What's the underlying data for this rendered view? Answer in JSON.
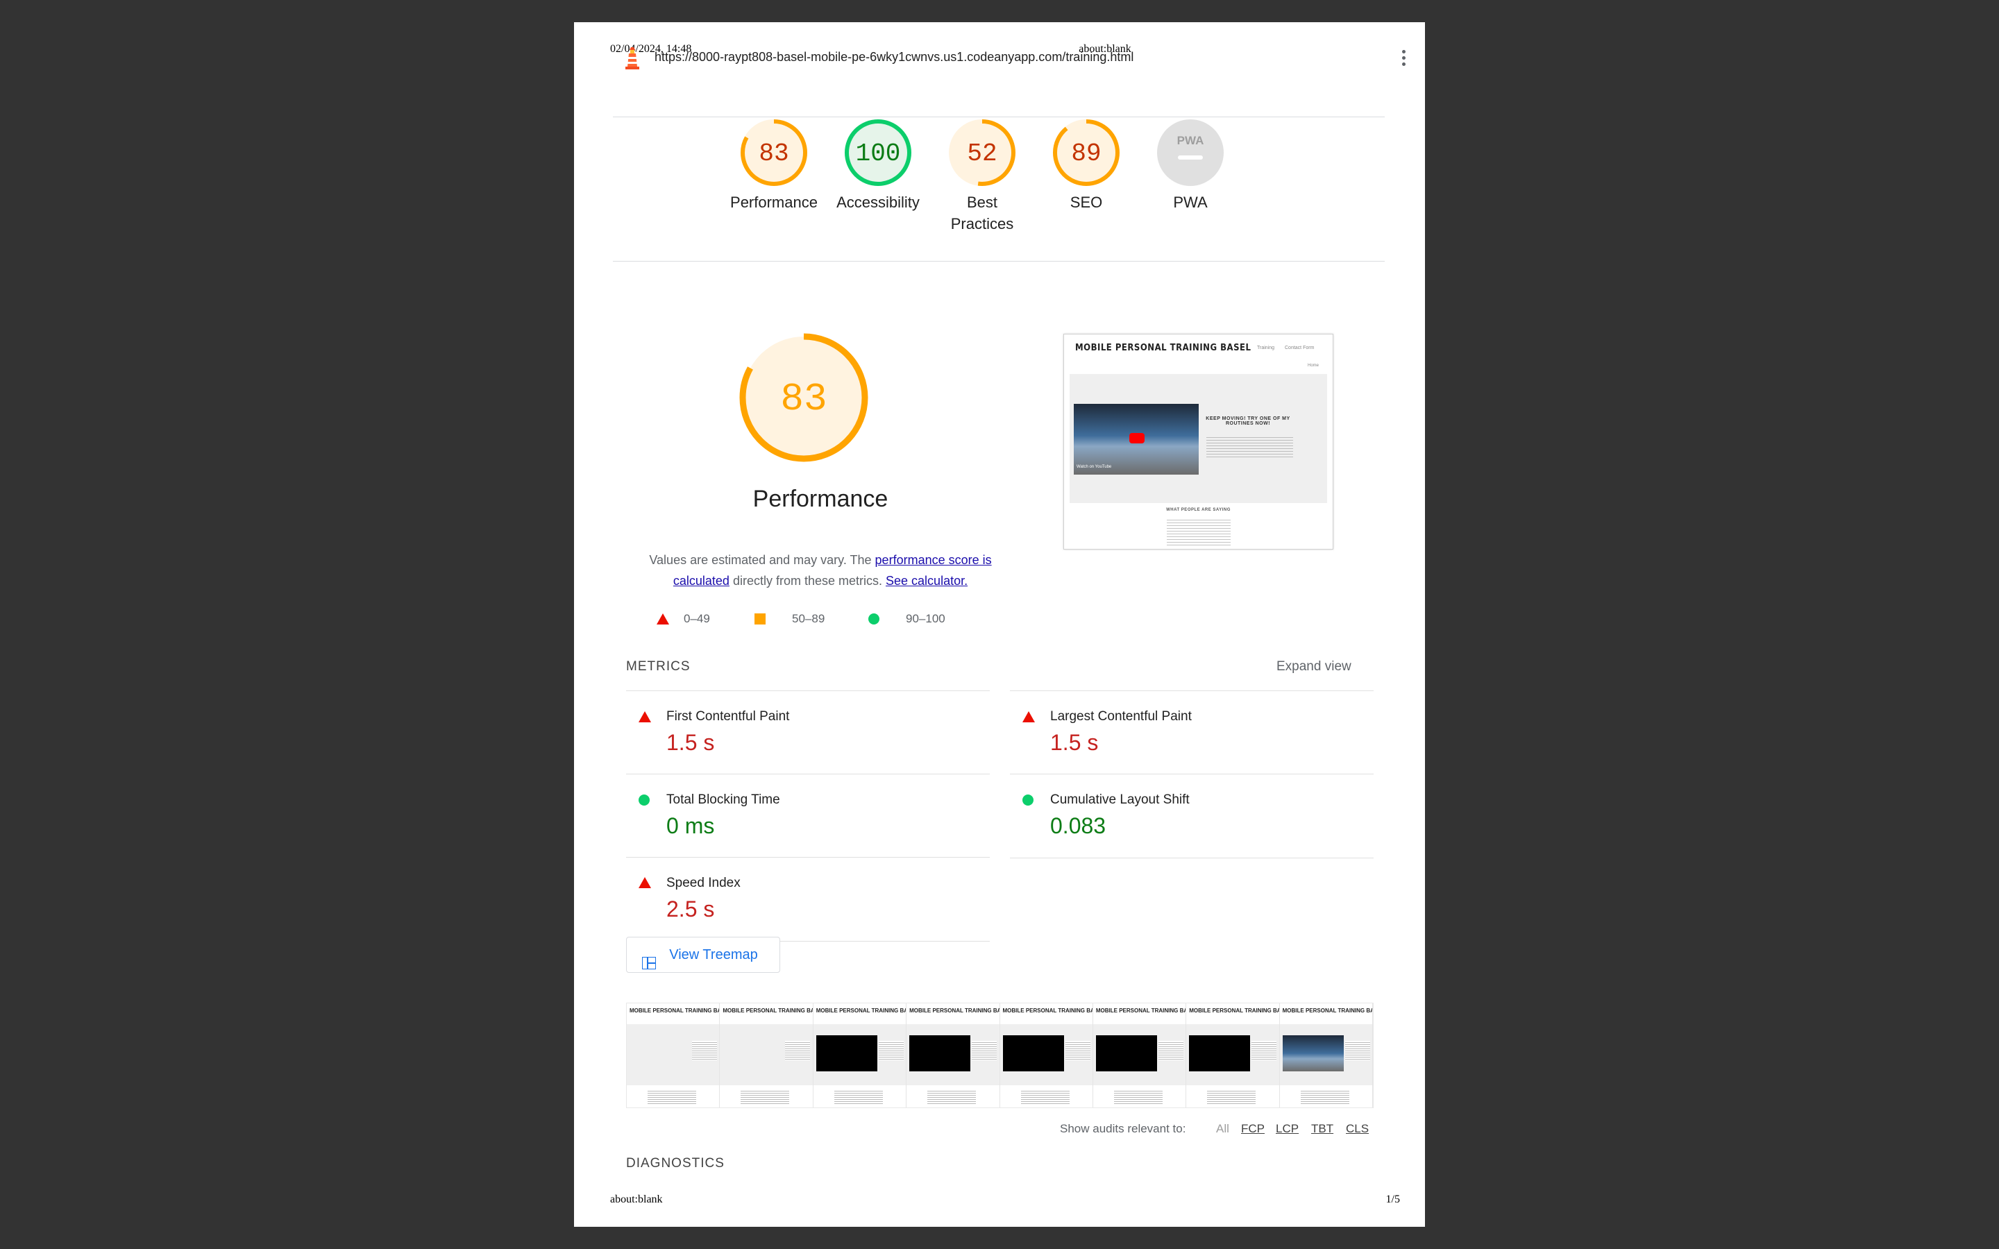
{
  "print_header": {
    "datetime": "02/04/2024, 14:48",
    "title": "about:blank"
  },
  "print_footer": {
    "left": "about:blank",
    "page": "1/5"
  },
  "topbar": {
    "url": "https://8000-raypt808-basel-mobile-pe-6wky1cwnvs.us1.codeanyapp.com/training.html"
  },
  "colors": {
    "average": "#e67700",
    "pass": "#0c7c15",
    "fail": "#c5221f",
    "gauge_avg_fill": "#fff3e0",
    "gauge_pass_fill": "#e6f4ea",
    "link": "#1a0dab",
    "treemap_btn": "#1a73e8"
  },
  "scores": [
    {
      "value": "83",
      "label": "Performance",
      "status": "average"
    },
    {
      "value": "100",
      "label": "Accessibility",
      "status": "pass"
    },
    {
      "value": "52",
      "label_line1": "Best",
      "label_line2": "Practices",
      "status": "average"
    },
    {
      "value": "89",
      "label": "SEO",
      "status": "average"
    },
    {
      "value": "",
      "label": "PWA",
      "badge": "PWA",
      "status": "na"
    }
  ],
  "performance": {
    "score": "83",
    "title": "Performance",
    "desc_part1": "Values are estimated and may vary. The ",
    "desc_link1": "performance score is calculated",
    "desc_part2": " directly from these metrics. ",
    "desc_link2": "See calculator.",
    "legend": [
      "0–49",
      "50–89",
      "90–100"
    ]
  },
  "screenshot": {
    "site_title": "MOBILE PERSONAL TRAINING BASEL",
    "nav1": "Training",
    "nav2": "Contact Form",
    "nav3": "Home",
    "heading": "KEEP MOVING! TRY ONE OF MY ROUTINES NOW!",
    "section": "WHAT PEOPLE ARE SAYING",
    "watch_on": "Watch on YouTube"
  },
  "metrics": {
    "header": "METRICS",
    "expand": "Expand view",
    "items": [
      {
        "title": "First Contentful Paint",
        "value": "1.5 s",
        "status": "fail"
      },
      {
        "title": "Largest Contentful Paint",
        "value": "1.5 s",
        "status": "fail"
      },
      {
        "title": "Total Blocking Time",
        "value": "0 ms",
        "status": "pass"
      },
      {
        "title": "Cumulative Layout Shift",
        "value": "0.083",
        "status": "pass"
      },
      {
        "title": "Speed Index",
        "value": "2.5 s",
        "status": "fail"
      }
    ]
  },
  "treemap_button": "View Treemap",
  "filmstrip": {
    "frame_title": "MOBILE PERSONAL TRAINING BASEL",
    "frame_count": 8
  },
  "audit_filter": {
    "label": "Show audits relevant to:",
    "chips": [
      "All",
      "FCP",
      "LCP",
      "TBT",
      "CLS"
    ]
  },
  "diagnostics": "DIAGNOSTICS"
}
